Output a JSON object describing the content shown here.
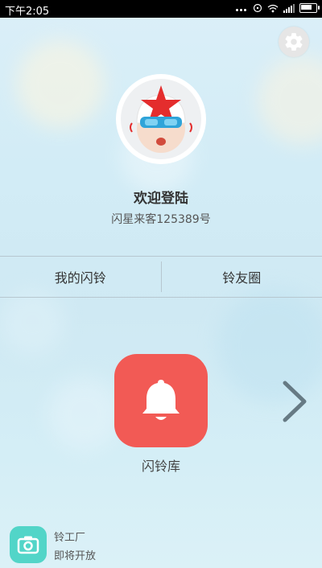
{
  "status_bar": {
    "time": "下午2:05"
  },
  "profile": {
    "welcome": "欢迎登陆",
    "guest_name": "闪星来客125389号"
  },
  "tabs": [
    {
      "label": "我的闪铃"
    },
    {
      "label": "铃友圈"
    }
  ],
  "main": {
    "library_label": "闪铃库"
  },
  "factory": {
    "title": "铃工厂",
    "subtitle": "即将开放"
  },
  "colors": {
    "accent_red": "#f25a55",
    "accent_teal": "#52d5c8"
  },
  "icons": {
    "settings": "gear-icon",
    "library": "bell-icon",
    "next": "chevron-right-icon",
    "factory": "camera-icon"
  }
}
